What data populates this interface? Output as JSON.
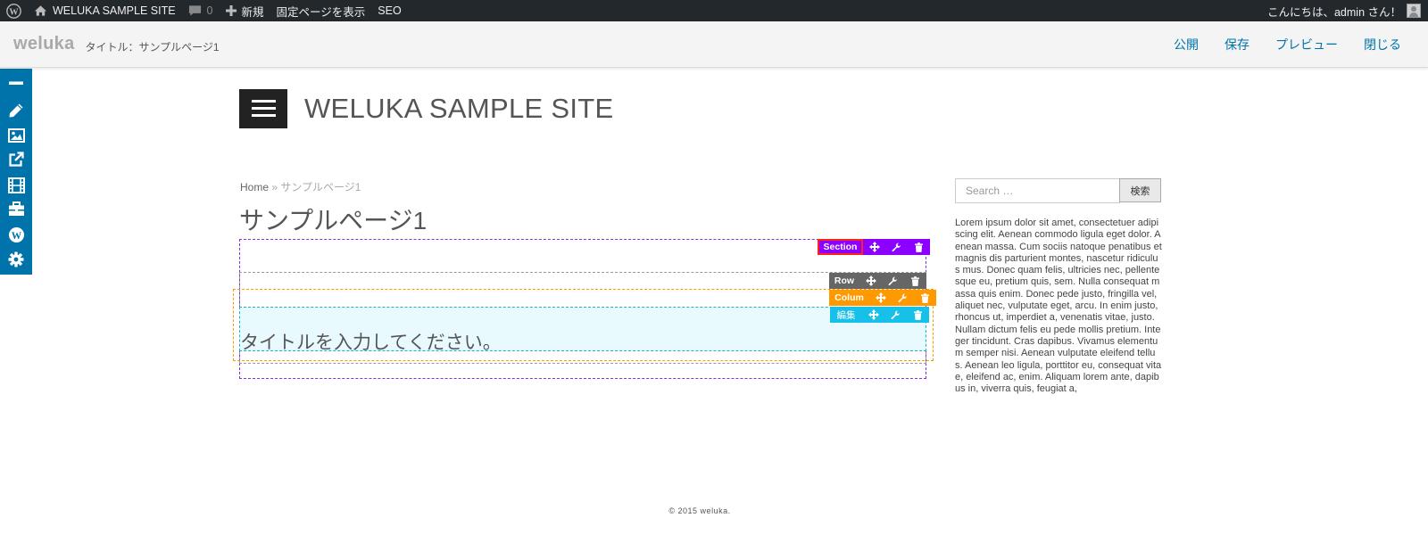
{
  "admin_bar": {
    "site_name": "WELUKA SAMPLE SITE",
    "comments_count": "0",
    "new_label": "新規",
    "view_page_label": "固定ページを表示",
    "seo_label": "SEO",
    "greeting": "こんにちは、admin さん！"
  },
  "editor_bar": {
    "brand": "weluka",
    "title": "タイトル：サンプルページ1",
    "actions": [
      "公開",
      "保存",
      "プレビュー",
      "閉じる"
    ]
  },
  "side_tools": [
    "minimize-icon",
    "pencil-icon",
    "image-icon",
    "external-link-icon",
    "film-icon",
    "briefcase-icon",
    "wordpress-icon",
    "gear-icon"
  ],
  "site": {
    "title": "WELUKA SAMPLE SITE"
  },
  "breadcrumb": {
    "home": "Home",
    "separator": "»",
    "current": "サンプルページ1"
  },
  "page": {
    "title": "サンプルページ1"
  },
  "builder": {
    "section_label": "Section",
    "row_label": "Row",
    "column_label": "Colum",
    "module_label": "編集",
    "module_text": "タイトルを入力してください。",
    "colors": {
      "section": "#8b00ff",
      "row": "#666666",
      "column": "#ff9900",
      "module": "#17c0e8",
      "highlight": "#ff2020"
    }
  },
  "sidebar": {
    "search_placeholder": "Search …",
    "search_button": "検索",
    "text": "Lorem ipsum dolor sit amet, consectetuer adipiscing elit. Aenean commodo ligula eget dolor. Aenean massa. Cum sociis natoque penatibus et magnis dis parturient montes, nascetur ridiculus mus. Donec quam felis, ultricies nec, pellentesque eu, pretium quis, sem. Nulla consequat massa quis enim. Donec pede justo, fringilla vel, aliquet nec, vulputate eget, arcu. In enim justo, rhoncus ut, imperdiet a, venenatis vitae, justo. Nullam dictum felis eu pede mollis pretium. Integer tincidunt. Cras dapibus. Vivamus elementum semper nisi. Aenean vulputate eleifend tellus. Aenean leo ligula, porttitor eu, consequat vitae, eleifend ac, enim. Aliquam lorem ante, dapibus in, viverra quis, feugiat a,"
  },
  "footer": {
    "copyright": "© 2015 weluka."
  }
}
